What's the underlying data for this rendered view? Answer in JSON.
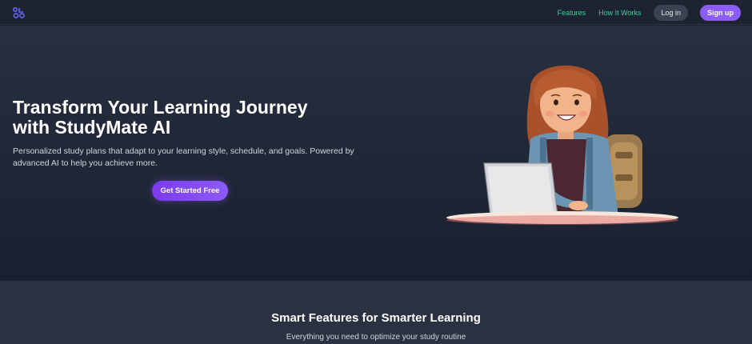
{
  "nav": {
    "logo_icon": "brand-logo-icon",
    "links": [
      {
        "label": "Features"
      },
      {
        "label": "How It Works"
      }
    ],
    "login_label": "Log in",
    "signup_label": "Sign up"
  },
  "hero": {
    "title_line1": "Transform Your Learning Journey",
    "title_line2": "with StudyMate AI",
    "subtitle": "Personalized study plans that adapt to your learning style, schedule, and goals. Powered by advanced AI to help you achieve more.",
    "cta_label": "Get Started Free",
    "illustration": "student-with-laptop-illustration"
  },
  "features": {
    "title": "Smart Features for Smarter Learning",
    "subtitle": "Everything you need to optimize your study routine"
  },
  "colors": {
    "accent": "#8b5cf6",
    "nav_link": "#34d399",
    "background": "#1b2130"
  }
}
